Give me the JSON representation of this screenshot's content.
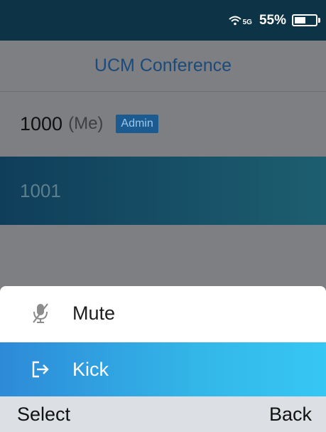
{
  "status_bar": {
    "network": "5G",
    "battery_percent": "55%",
    "battery_level": 0.55
  },
  "header": {
    "title": "UCM Conference"
  },
  "participants": [
    {
      "number": "1000",
      "suffix": "(Me)",
      "badge": "Admin"
    },
    {
      "number": "1001",
      "selected": true
    }
  ],
  "menu": {
    "items": [
      {
        "label": "Mute",
        "icon": "mic-muted-icon"
      },
      {
        "label": "Kick",
        "icon": "exit-icon",
        "selected": true
      }
    ]
  },
  "softkeys": {
    "left": "Select",
    "right": "Back"
  }
}
